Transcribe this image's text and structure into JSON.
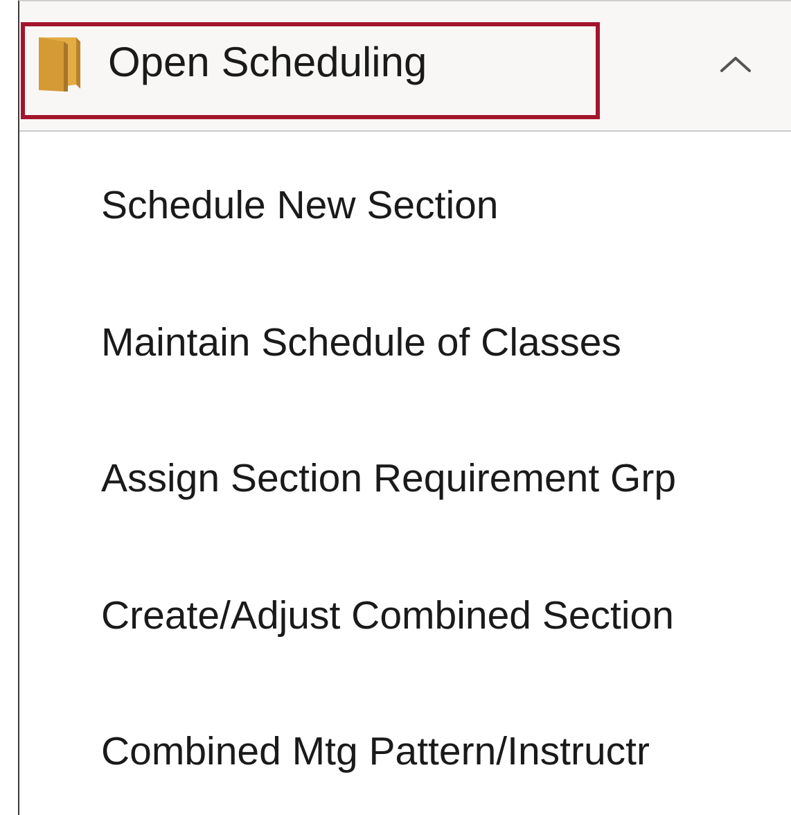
{
  "navigation": {
    "folder": {
      "title": "Open Scheduling",
      "icon": "folder-icon",
      "toggle_icon": "chevron-up-icon",
      "expanded": true,
      "highlight_color": "#a3152d",
      "folder_color": "#e0a83e"
    },
    "items": [
      {
        "label": "Schedule New Section"
      },
      {
        "label": "Maintain Schedule of Classes"
      },
      {
        "label": "Assign Section Requirement Grp"
      },
      {
        "label": "Create/Adjust Combined Section"
      },
      {
        "label": "Combined Mtg Pattern/Instructr"
      }
    ]
  }
}
